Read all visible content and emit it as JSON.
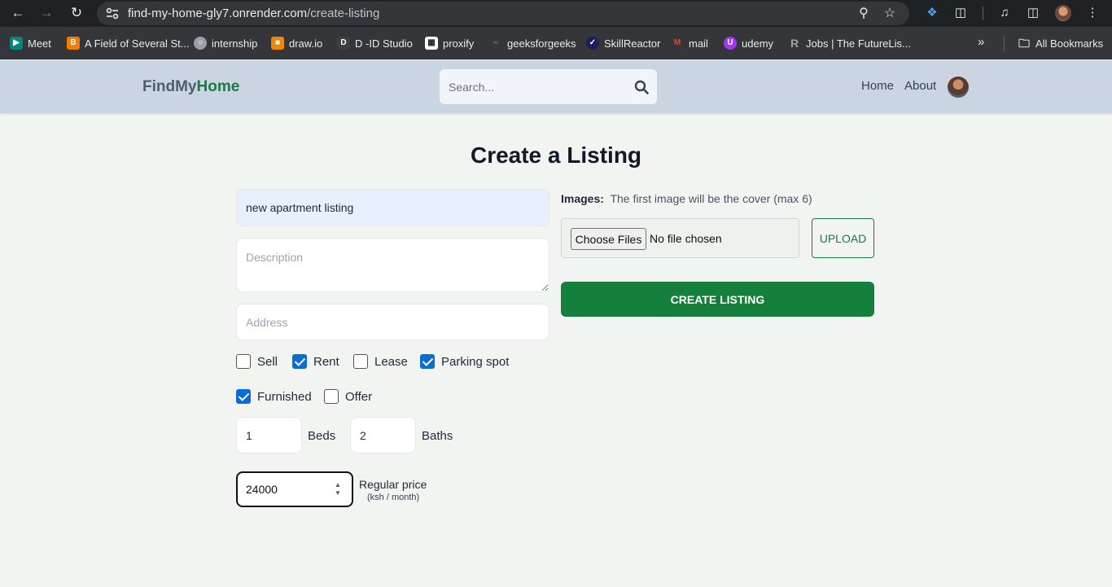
{
  "browser": {
    "url_host": "find-my-home-gly7.onrender.com",
    "url_path": "/create-listing",
    "bookmarks": [
      {
        "label": "Meet",
        "icon": "meet-icon",
        "color": "#00897b"
      },
      {
        "label": "A Field of Several St...",
        "icon": "blogger-icon",
        "color": "#f57c00"
      },
      {
        "label": "internship",
        "icon": "globe-icon",
        "color": "#9aa0a6"
      },
      {
        "label": "draw.io",
        "icon": "drawio-icon",
        "color": "#f08705"
      },
      {
        "label": "D -ID Studio",
        "icon": "did-icon",
        "color": "#3c4043"
      },
      {
        "label": "proxify",
        "icon": "proxify-icon",
        "color": "#ffffff"
      },
      {
        "label": "geeksforgeeks",
        "icon": "gfg-icon",
        "color": "#2f8d46"
      },
      {
        "label": "SkillReactor",
        "icon": "skillreactor-icon",
        "color": "#1a1f5c"
      },
      {
        "label": "mail",
        "icon": "gmail-icon",
        "color": "#ea4335"
      },
      {
        "label": "udemy",
        "icon": "udemy-icon",
        "color": "#a435f0"
      },
      {
        "label": "Jobs | The FutureLis...",
        "icon": "futurelist-icon",
        "color": "#202124"
      }
    ],
    "all_bookmarks": "All Bookmarks"
  },
  "header": {
    "logo_part1": "FindMy",
    "logo_part2": "Home",
    "search_placeholder": "Search...",
    "nav_home": "Home",
    "nav_about": "About"
  },
  "form": {
    "title": "Create a Listing",
    "name_value": "new apartment listing",
    "description_placeholder": "Description",
    "address_placeholder": "Address",
    "checkboxes": [
      {
        "label": "Sell",
        "checked": false
      },
      {
        "label": "Rent",
        "checked": true
      },
      {
        "label": "Lease",
        "checked": false
      },
      {
        "label": "Parking spot",
        "checked": true
      },
      {
        "label": "Furnished",
        "checked": true
      },
      {
        "label": "Offer",
        "checked": false
      }
    ],
    "beds_value": "1",
    "beds_label": "Beds",
    "baths_value": "2",
    "baths_label": "Baths",
    "price_value": "24000",
    "price_label": "Regular price",
    "price_sublabel": "(ksh / month)",
    "images_label": "Images:",
    "images_hint": "The first image will be the cover (max 6)",
    "choose_files": "Choose Files",
    "no_file": "No file chosen",
    "upload": "UPLOAD",
    "create": "CREATE LISTING"
  },
  "colors": {
    "brand_green": "#15803d",
    "header_bg": "#cbd5e1",
    "checkbox_blue": "#0b6cd8"
  }
}
